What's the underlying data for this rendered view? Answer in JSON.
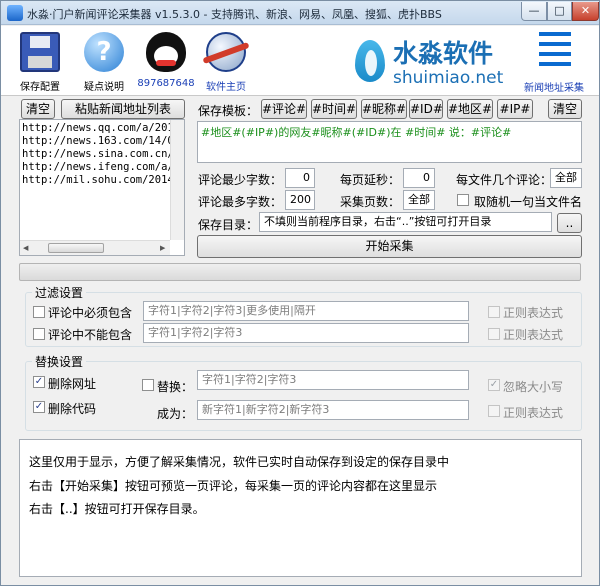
{
  "window": {
    "title": "水淼·门户新闻评论采集器 v1.5.3.0 - 支持腾讯、新浪、网易、凤凰、搜狐、虎扑BBS",
    "minimize": "—",
    "maximize": "□",
    "close": "✕"
  },
  "toolbar": {
    "save_config": "保存配置",
    "help": "疑点说明",
    "help_glyph": "?",
    "qq": "897687648",
    "homepage": "软件主页",
    "news_urls": "新闻地址采集"
  },
  "brand": {
    "name_cn": "水淼软件",
    "name_en": "shuimiao.net"
  },
  "left": {
    "clear_label": "清空",
    "paste_label": "粘贴新闻地址列表",
    "urls": [
      "http://news.qq.com/a/201",
      "http://news.163.com/14/0",
      "http://news.sina.com.cn/",
      "http://news.ifeng.com/a/",
      "http://mil.sohu.com/2014"
    ]
  },
  "template": {
    "label": "保存模板：",
    "tags": [
      "#评论#",
      "#时间#",
      "#昵称#",
      "#ID#",
      "#地区#",
      "#IP#"
    ],
    "clear_label": "清空",
    "content": "#地区#(#IP#)的网友#昵称#(#ID#)在 #时间# 说：#评论#"
  },
  "settings": {
    "min_chars_label": "评论最少字数：",
    "min_chars": "0",
    "delay_label": "每页延秒：",
    "delay": "0",
    "per_file_label": "每文件几个评论：",
    "per_file": "全部",
    "max_chars_label": "评论最多字数：",
    "max_chars": "200",
    "pages_label": "采集页数：",
    "pages": "全部",
    "random_name_label": "取随机一句当文件名",
    "save_dir_label": "保存目录：",
    "save_dir_placeholder": "不填则当前程序目录，右击“..”按钮可打开目录",
    "browse_label": "..",
    "start_label": "开始采集"
  },
  "filter": {
    "legend": "过滤设置",
    "must_include_label": "评论中必须包含",
    "must_include_placeholder": "字符1|字符2|字符3|更多使用|隔开",
    "must_not_label": "评论中不能包含",
    "must_not_placeholder": "字符1|字符2|字符3",
    "regex_label": "正则表达式"
  },
  "replace": {
    "legend": "替换设置",
    "remove_url_label": "删除网址",
    "remove_code_label": "删除代码",
    "replace_label": "替换：",
    "replace_placeholder": "字符1|字符2|字符3",
    "to_label": "成为：",
    "to_placeholder": "新字符1|新字符2|新字符3",
    "ignore_case_label": "忽略大小写",
    "regex_label": "正则表达式",
    "check_mark": "✓"
  },
  "log": {
    "lines": [
      "这里仅用于显示，方便了解采集情况，软件已实时自动保存到设定的保存目录中",
      "右击【开始采集】按钮可预览一页评论，每采集一页的评论内容都在这里显示",
      "右击【..】按钮可打开保存目录。"
    ]
  },
  "colors": {
    "accent": "#1b6fb4",
    "template_text": "#1b8f1b",
    "link": "#1a3fb5"
  }
}
